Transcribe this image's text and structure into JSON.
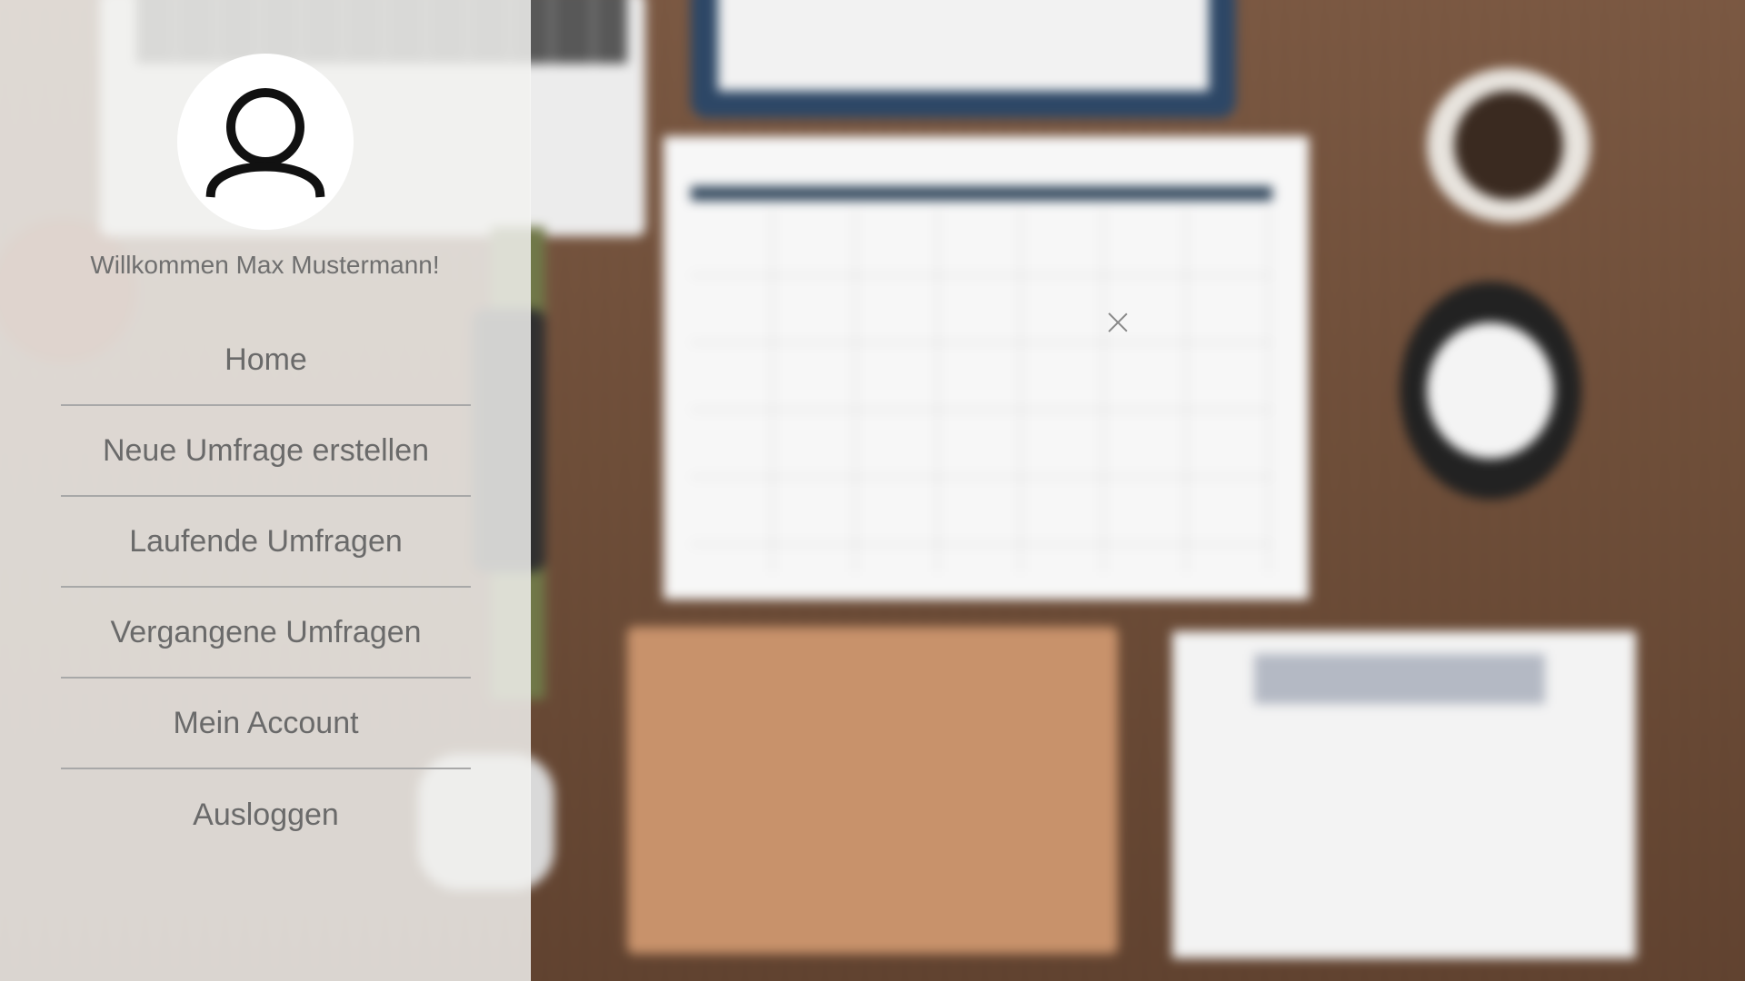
{
  "sidebar": {
    "avatar_icon": "user-icon",
    "welcome_text": "Willkommen Max Mustermann!",
    "nav": [
      {
        "label": "Home",
        "icon": ""
      },
      {
        "label": "Neue Umfrage erstellen"
      },
      {
        "label": "Laufende Umfragen"
      },
      {
        "label": "Vergangene Umfragen"
      },
      {
        "label": "Mein Account"
      },
      {
        "label": "Ausloggen"
      }
    ]
  },
  "background": {
    "description_icon": "close-icon"
  },
  "colors": {
    "panel": "#f2f2f0",
    "text": "#6a6a6a",
    "divider": "#a8a8a8"
  }
}
